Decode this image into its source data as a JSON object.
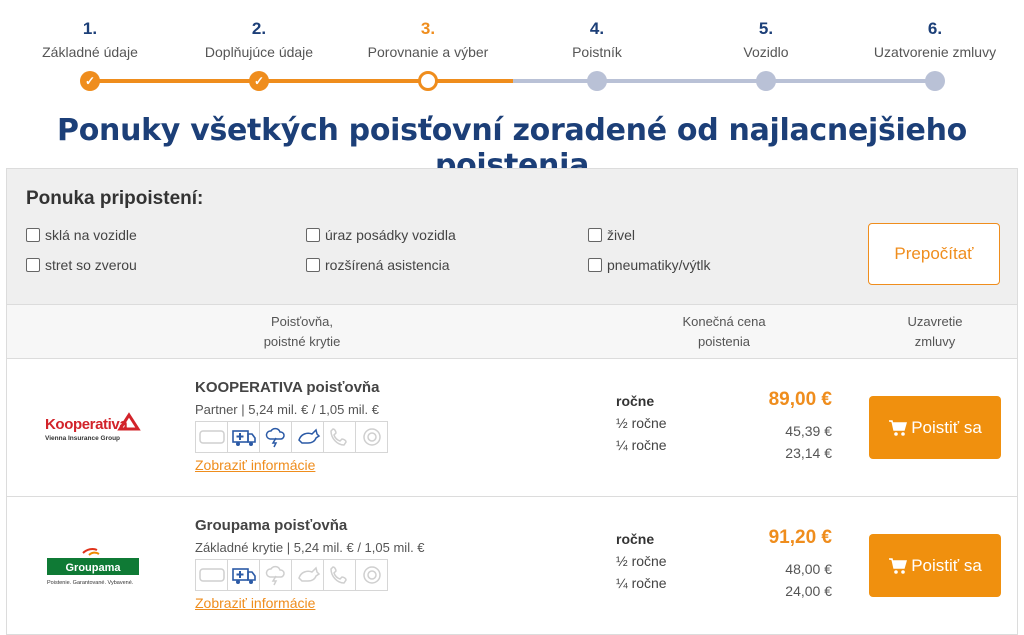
{
  "stepper": {
    "steps": [
      {
        "num": "1.",
        "label": "Základné údaje",
        "state": "done"
      },
      {
        "num": "2.",
        "label": "Doplňujúce údaje",
        "state": "done"
      },
      {
        "num": "3.",
        "label": "Porovnanie a výber",
        "state": "current"
      },
      {
        "num": "4.",
        "label": "Poistník",
        "state": "todo"
      },
      {
        "num": "5.",
        "label": "Vozidlo",
        "state": "todo"
      },
      {
        "num": "6.",
        "label": "Uzatvorenie zmluvy",
        "state": "todo"
      }
    ]
  },
  "heading": "Ponuky všetkých poisťovní zoradené od najlacnejšieho poistenia",
  "addons": {
    "title": "Ponuka pripoistení:",
    "options": [
      "sklá na vozidle",
      "úraz posádky vozidla",
      "živel",
      "stret so zverou",
      "rozšírená asistencia",
      "pneumatiky/výtlk"
    ],
    "recalc_label": "Prepočítať"
  },
  "table": {
    "col_insurer_line1": "Poisťovňa,",
    "col_insurer_line2": "poistné krytie",
    "col_price_line1": "Konečná cena",
    "col_price_line2": "poistenia",
    "col_contract_line1": "Uzavretie",
    "col_contract_line2": "zmluvy"
  },
  "offers": [
    {
      "name": "KOOPERATIVA poisťovňa",
      "coverage": "Partner  |  5,24 mil. € / 1,05 mil. €",
      "logo_text": "Kooperativa",
      "logo_sub": "Vienna Insurance Group",
      "info_link": "Zobraziť informácie",
      "period_yearly": "ročne",
      "period_half": "½ ročne",
      "period_quarter": "¼ ročne",
      "price_yearly": "89,00 €",
      "price_half": "45,39 €",
      "price_quarter": "23,14 €",
      "buy_label": "Poistiť sa"
    },
    {
      "name": "Groupama poisťovňa",
      "coverage": "Základné krytie  |  5,24 mil. € / 1,05 mil. €",
      "logo_text": "Groupama",
      "logo_sub": "Poistenie. Garantované. Vybavené.",
      "info_link": "Zobraziť informácie",
      "period_yearly": "ročne",
      "period_half": "½ ročne",
      "period_quarter": "¼ ročne",
      "price_yearly": "91,20 €",
      "price_half": "48,00 €",
      "price_quarter": "24,00 €",
      "buy_label": "Poistiť sa"
    }
  ],
  "colors": {
    "accent": "#ef8d1d",
    "brand_blue": "#1c3f78",
    "step_inactive": "#b9c1d6"
  }
}
